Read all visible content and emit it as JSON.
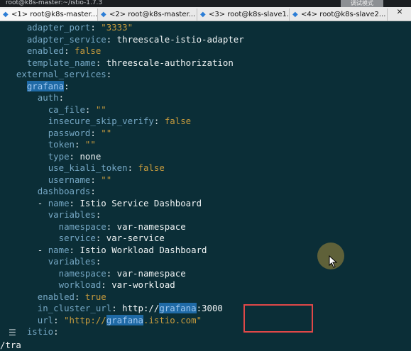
{
  "window": {
    "title": "root@k8s-master:~/istio-1.7.3"
  },
  "notice": "调试模式",
  "tabs": [
    {
      "label": "<1> root@k8s-master...",
      "active": true
    },
    {
      "label": "<2> root@k8s-master...",
      "active": false
    },
    {
      "label": "<3> root@k8s-slave1...",
      "active": false
    },
    {
      "label": "<4> root@k8s-slave2...",
      "active": false
    }
  ],
  "tab_close": "✕",
  "lines": [
    {
      "indent": "    ",
      "key": "adapter_port",
      "sep": ": ",
      "val": "\"3333\"",
      "cls": "s"
    },
    {
      "indent": "    ",
      "key": "adapter_service",
      "sep": ": ",
      "val": "threescale-istio-adapter",
      "cls": "v"
    },
    {
      "indent": "    ",
      "key": "enabled",
      "sep": ": ",
      "val": "false",
      "cls": "b"
    },
    {
      "indent": "    ",
      "key": "template_name",
      "sep": ": ",
      "val": "threescale-authorization",
      "cls": "v"
    },
    {
      "indent": "  ",
      "key": "external_services",
      "sep": ":",
      "val": "",
      "cls": "v"
    },
    {
      "indent": "    ",
      "key": "grafana",
      "sep": ":",
      "val": "",
      "cls": "v",
      "hl": true
    },
    {
      "indent": "      ",
      "key": "auth",
      "sep": ":",
      "val": "",
      "cls": "v"
    },
    {
      "indent": "        ",
      "key": "ca_file",
      "sep": ": ",
      "val": "\"\"",
      "cls": "s"
    },
    {
      "indent": "        ",
      "key": "insecure_skip_verify",
      "sep": ": ",
      "val": "false",
      "cls": "b"
    },
    {
      "indent": "        ",
      "key": "password",
      "sep": ": ",
      "val": "\"\"",
      "cls": "s"
    },
    {
      "indent": "        ",
      "key": "token",
      "sep": ": ",
      "val": "\"\"",
      "cls": "s"
    },
    {
      "indent": "        ",
      "key": "type",
      "sep": ": ",
      "val": "none",
      "cls": "v"
    },
    {
      "indent": "        ",
      "key": "use_kiali_token",
      "sep": ": ",
      "val": "false",
      "cls": "b"
    },
    {
      "indent": "        ",
      "key": "username",
      "sep": ": ",
      "val": "\"\"",
      "cls": "s"
    },
    {
      "indent": "      ",
      "key": "dashboards",
      "sep": ":",
      "val": "",
      "cls": "v"
    },
    {
      "indent": "      - ",
      "key": "name",
      "sep": ": ",
      "val": "Istio Service Dashboard",
      "cls": "v"
    },
    {
      "indent": "        ",
      "key": "variables",
      "sep": ":",
      "val": "",
      "cls": "v"
    },
    {
      "indent": "          ",
      "key": "namespace",
      "sep": ": ",
      "val": "var-namespace",
      "cls": "v"
    },
    {
      "indent": "          ",
      "key": "service",
      "sep": ": ",
      "val": "var-service",
      "cls": "v"
    },
    {
      "indent": "      - ",
      "key": "name",
      "sep": ": ",
      "val": "Istio Workload Dashboard",
      "cls": "v"
    },
    {
      "indent": "        ",
      "key": "variables",
      "sep": ":",
      "val": "",
      "cls": "v"
    },
    {
      "indent": "          ",
      "key": "namespace",
      "sep": ": ",
      "val": "var-namespace",
      "cls": "v"
    },
    {
      "indent": "          ",
      "key": "workload",
      "sep": ": ",
      "val": "var-workload",
      "cls": "v"
    },
    {
      "indent": "      ",
      "key": "enabled",
      "sep": ": ",
      "val": "true",
      "cls": "b"
    },
    {
      "indent": "      ",
      "key": "in_cluster_url",
      "sep": ": ",
      "val_parts": [
        "http://",
        "grafana",
        ":3000"
      ],
      "cls": "v"
    },
    {
      "indent": "      ",
      "key": "url",
      "sep": ": ",
      "val_parts": [
        "\"http://",
        "grafana",
        ".istio.com\""
      ],
      "cls": "s"
    },
    {
      "indent": "    ",
      "key": "istio",
      "sep": ":",
      "val": "",
      "cls": "v"
    }
  ],
  "command_line": "/tra",
  "icons": {
    "tab": "terminal-icon",
    "menu": "menu-icon",
    "pointer": "mouse-pointer-icon"
  }
}
